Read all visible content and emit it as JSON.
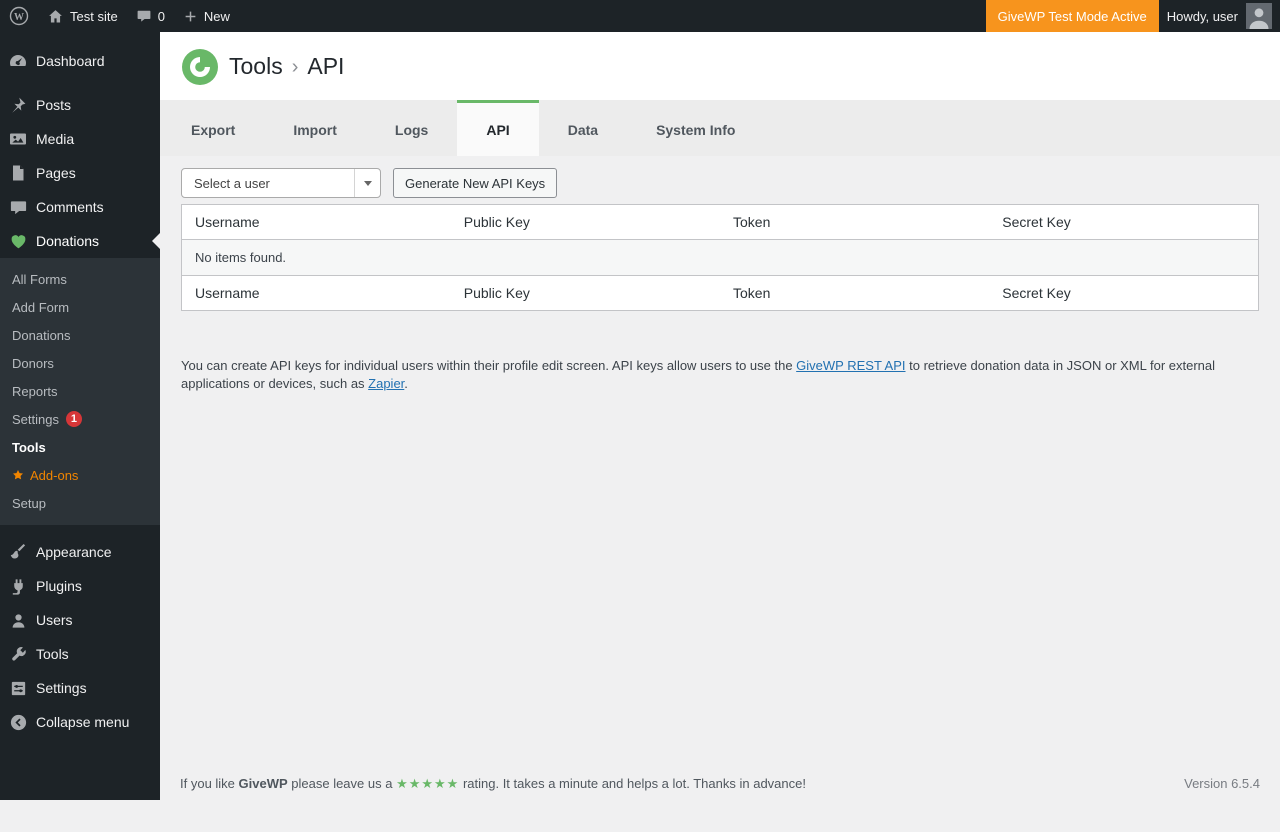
{
  "admin_bar": {
    "site_name": "Test site",
    "comments_count": "0",
    "new_label": "New",
    "test_mode_badge": "GiveWP Test Mode Active",
    "howdy": "Howdy, user"
  },
  "sidebar": {
    "items": [
      {
        "label": "Dashboard"
      },
      {
        "label": "Posts"
      },
      {
        "label": "Media"
      },
      {
        "label": "Pages"
      },
      {
        "label": "Comments"
      },
      {
        "label": "Donations"
      },
      {
        "label": "Appearance"
      },
      {
        "label": "Plugins"
      },
      {
        "label": "Users"
      },
      {
        "label": "Tools"
      },
      {
        "label": "Settings"
      },
      {
        "label": "Collapse menu"
      }
    ],
    "donations_submenu": {
      "items": [
        "All Forms",
        "Add Form",
        "Donations",
        "Donors",
        "Reports",
        "Settings",
        "Tools",
        "Add-ons",
        "Setup"
      ],
      "settings_badge": "1",
      "current_item": "Tools"
    }
  },
  "header": {
    "breadcrumb": {
      "parent": "Tools",
      "separator": "›",
      "current": "API"
    }
  },
  "tabs": {
    "items": [
      "Export",
      "Import",
      "Logs",
      "API",
      "Data",
      "System Info"
    ],
    "active": "API"
  },
  "controls": {
    "user_select_value": "Select a user",
    "generate_button_label": "Generate New API Keys"
  },
  "table": {
    "columns": [
      "Username",
      "Public Key",
      "Token",
      "Secret Key"
    ],
    "empty_message": "No items found."
  },
  "description": {
    "text_1": "You can create API keys for individual users within their profile edit screen. API keys allow users to use the ",
    "link_rest_api": "GiveWP REST API",
    "text_2": " to retrieve donation data in JSON or XML for external applications or devices, such as ",
    "link_zapier": "Zapier",
    "text_3": "."
  },
  "footer": {
    "text_1": "If you like ",
    "brand": "GiveWP",
    "text_2": " please leave us a ",
    "stars": "★★★★★",
    "text_3": " rating. It takes a minute and helps a lot. Thanks in advance!",
    "version": "Version 6.5.4"
  },
  "colors": {
    "brand_green": "#69b868",
    "test_mode_orange": "#f7941d",
    "badge_red": "#d63638",
    "link_blue": "#2271b1",
    "addons_orange": "#f18500"
  }
}
